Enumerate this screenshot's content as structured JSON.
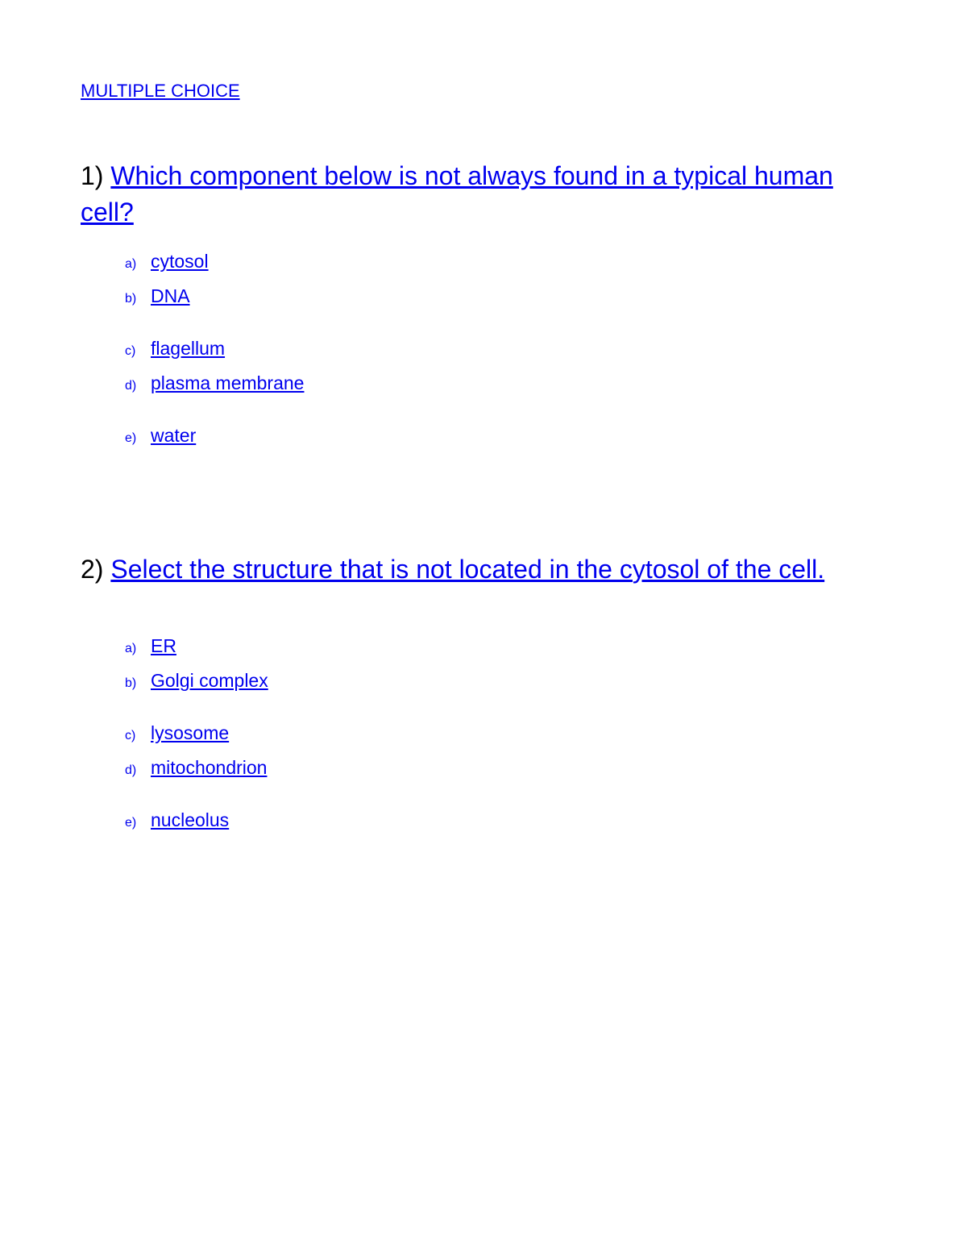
{
  "header": "MULTIPLE CHOICE",
  "questions": [
    {
      "number": "1)",
      "text": "Which component below is not always found in a typical human cell?",
      "options": [
        {
          "label": "a)",
          "text": "cytosol",
          "gap_after": false
        },
        {
          "label": "b)",
          "text": "DNA",
          "gap_after": true
        },
        {
          "label": "c)",
          "text": "flagellum",
          "gap_after": false
        },
        {
          "label": "d)",
          "text": "plasma membrane",
          "gap_after": true
        },
        {
          "label": "e)",
          "text": "water",
          "gap_after": false
        }
      ]
    },
    {
      "number": "2)",
      "text": "Select the structure that is not located in the cytosol of the cell.",
      "options": [
        {
          "label": "a)",
          "text": "ER",
          "gap_after": false
        },
        {
          "label": "b)",
          "text": "Golgi complex",
          "gap_after": true
        },
        {
          "label": "c)",
          "text": "lysosome",
          "gap_after": false
        },
        {
          "label": "d)",
          "text": "mitochondrion",
          "gap_after": true
        },
        {
          "label": "e)",
          "text": "nucleolus",
          "gap_after": false
        }
      ]
    }
  ]
}
